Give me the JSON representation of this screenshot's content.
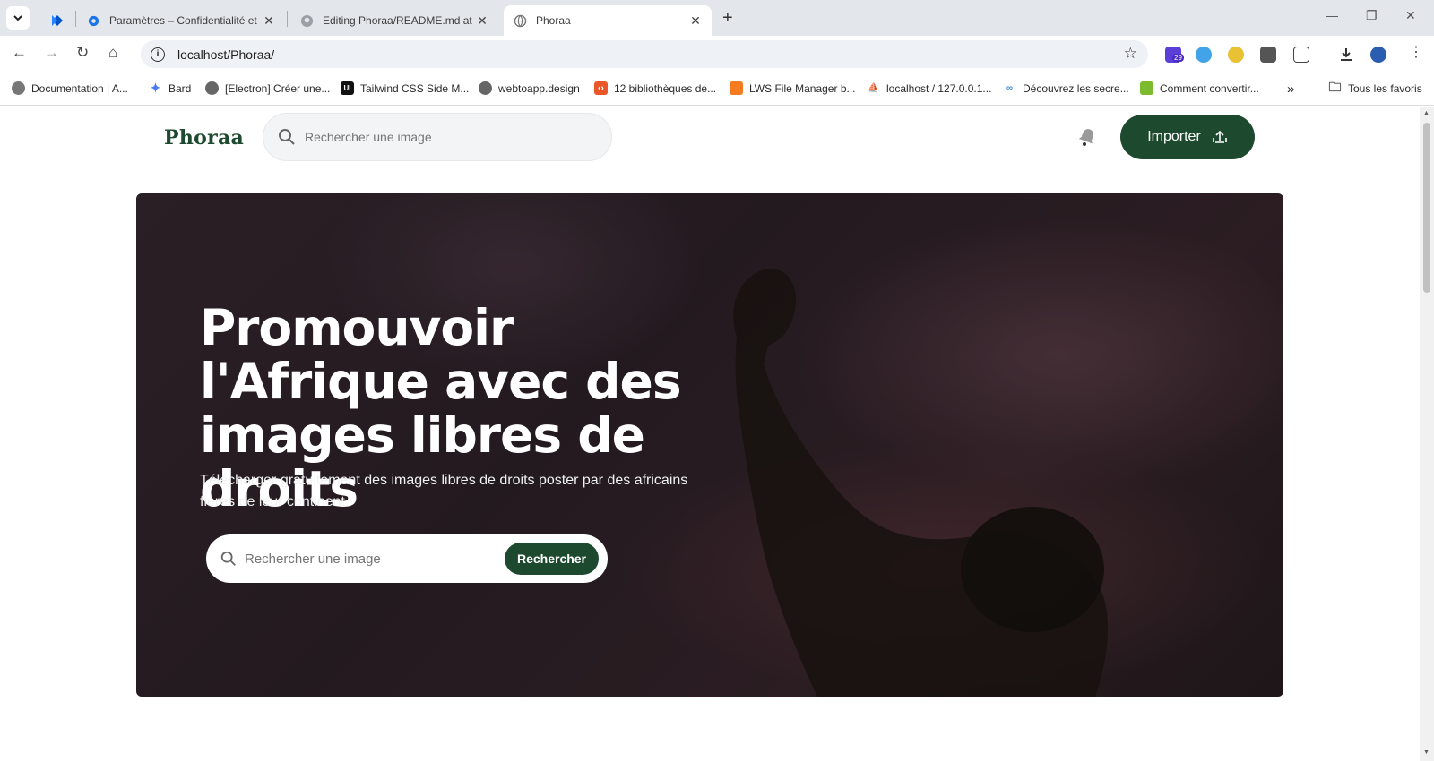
{
  "browser": {
    "tabs": [
      {
        "title": "",
        "favicon": "jira-icon",
        "active": false
      },
      {
        "title": "Paramètres – Confidentialité et",
        "favicon": "gear-icon",
        "active": false
      },
      {
        "title": "Editing Phoraa/README.md at",
        "favicon": "github-icon",
        "active": false
      },
      {
        "title": "Phoraa",
        "favicon": "globe-icon",
        "active": true
      }
    ],
    "url": "localhost/Phoraa/",
    "extension_badge": "29",
    "bookmarks": [
      {
        "label": "Documentation | A...",
        "icon": "globe-icon"
      },
      {
        "label": "Bard",
        "icon": "sparkle-icon"
      },
      {
        "label": "[Electron] Créer une...",
        "icon": "globe-icon"
      },
      {
        "label": "Tailwind CSS Side M...",
        "icon": "ui-icon"
      },
      {
        "label": "webtoapp.design",
        "icon": "globe-icon"
      },
      {
        "label": "12 bibliothèques de...",
        "icon": "code-icon"
      },
      {
        "label": "LWS File Manager b...",
        "icon": "lws-icon"
      },
      {
        "label": "localhost / 127.0.0.1...",
        "icon": "pma-icon"
      },
      {
        "label": "Découvrez les secre...",
        "icon": "link-icon"
      },
      {
        "label": "Comment convertir...",
        "icon": "leaf-icon"
      }
    ],
    "all_bookmarks_label": "Tous les favoris"
  },
  "header": {
    "logo": "Phoraa",
    "search_placeholder": "Rechercher une image",
    "import_label": "Importer"
  },
  "hero": {
    "title": "Promouvoir l'Afrique avec des images libres de droits",
    "subtitle": "Télécharger gratuitement des images libres de droits poster par des africains fières de leur continent.",
    "search_placeholder": "Rechercher une image",
    "search_button": "Rechercher"
  },
  "colors": {
    "brand_green": "#1d4a2e"
  }
}
